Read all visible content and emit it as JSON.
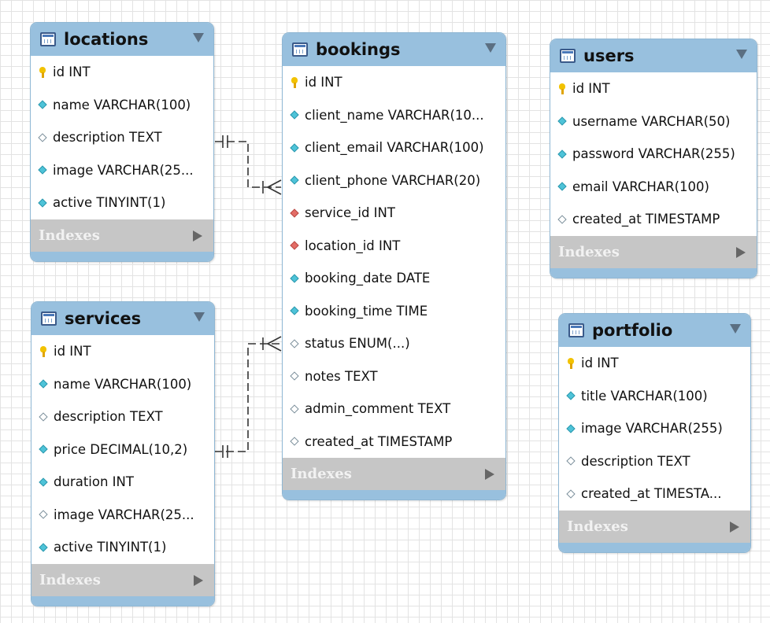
{
  "tables": [
    {
      "title": "locations",
      "columns": [
        {
          "text": "id INT",
          "icon": "primary-key-icon"
        },
        {
          "text": "name VARCHAR(100)",
          "icon": "not-null-column-icon"
        },
        {
          "text": "description TEXT",
          "icon": "nullable-column-icon"
        },
        {
          "text": "image VARCHAR(25...",
          "icon": "not-null-column-icon"
        },
        {
          "text": "active TINYINT(1)",
          "icon": "not-null-column-icon"
        }
      ],
      "indexes_label": "Indexes"
    },
    {
      "title": "bookings",
      "columns": [
        {
          "text": "id INT",
          "icon": "primary-key-icon"
        },
        {
          "text": "client_name VARCHAR(10...",
          "icon": "not-null-column-icon"
        },
        {
          "text": "client_email VARCHAR(100)",
          "icon": "not-null-column-icon"
        },
        {
          "text": "client_phone VARCHAR(20)",
          "icon": "not-null-column-icon"
        },
        {
          "text": "service_id INT",
          "icon": "foreign-key-icon"
        },
        {
          "text": "location_id INT",
          "icon": "foreign-key-icon"
        },
        {
          "text": "booking_date DATE",
          "icon": "not-null-column-icon"
        },
        {
          "text": "booking_time TIME",
          "icon": "not-null-column-icon"
        },
        {
          "text": "status ENUM(...)",
          "icon": "nullable-column-icon"
        },
        {
          "text": "notes TEXT",
          "icon": "nullable-column-icon"
        },
        {
          "text": "admin_comment TEXT",
          "icon": "nullable-column-icon"
        },
        {
          "text": "created_at TIMESTAMP",
          "icon": "nullable-column-icon"
        }
      ],
      "indexes_label": "Indexes"
    },
    {
      "title": "users",
      "columns": [
        {
          "text": "id INT",
          "icon": "primary-key-icon"
        },
        {
          "text": "username VARCHAR(50)",
          "icon": "not-null-column-icon"
        },
        {
          "text": "password VARCHAR(255)",
          "icon": "not-null-column-icon"
        },
        {
          "text": "email VARCHAR(100)",
          "icon": "not-null-column-icon"
        },
        {
          "text": "created_at TIMESTAMP",
          "icon": "nullable-column-icon"
        }
      ],
      "indexes_label": "Indexes"
    },
    {
      "title": "services",
      "columns": [
        {
          "text": "id INT",
          "icon": "primary-key-icon"
        },
        {
          "text": "name VARCHAR(100)",
          "icon": "not-null-column-icon"
        },
        {
          "text": "description TEXT",
          "icon": "nullable-column-icon"
        },
        {
          "text": "price DECIMAL(10,2)",
          "icon": "not-null-column-icon"
        },
        {
          "text": "duration INT",
          "icon": "not-null-column-icon"
        },
        {
          "text": "image VARCHAR(25...",
          "icon": "nullable-column-icon"
        },
        {
          "text": "active TINYINT(1)",
          "icon": "not-null-column-icon"
        }
      ],
      "indexes_label": "Indexes"
    },
    {
      "title": "portfolio",
      "columns": [
        {
          "text": "id INT",
          "icon": "primary-key-icon"
        },
        {
          "text": "title VARCHAR(100)",
          "icon": "not-null-column-icon"
        },
        {
          "text": "image VARCHAR(255)",
          "icon": "not-null-column-icon"
        },
        {
          "text": "description TEXT",
          "icon": "nullable-column-icon"
        },
        {
          "text": "created_at TIMESTA...",
          "icon": "nullable-column-icon"
        }
      ],
      "indexes_label": "Indexes"
    }
  ],
  "relationships": [
    {
      "from": "locations",
      "to": "bookings",
      "from_cardinality": "one-and-only-one",
      "to_cardinality": "zero-or-many",
      "line_style": "dashed"
    },
    {
      "from": "services",
      "to": "bookings",
      "from_cardinality": "one-and-only-one",
      "to_cardinality": "zero-or-many",
      "line_style": "dashed"
    }
  ],
  "colors": {
    "header": "#98c0de",
    "indexes_bar": "#c6c6c6",
    "grid": "#e3e3e3",
    "primary_key": "#f2c200",
    "not_null": "#4ec3d8",
    "foreign_key": "#e36c66"
  }
}
